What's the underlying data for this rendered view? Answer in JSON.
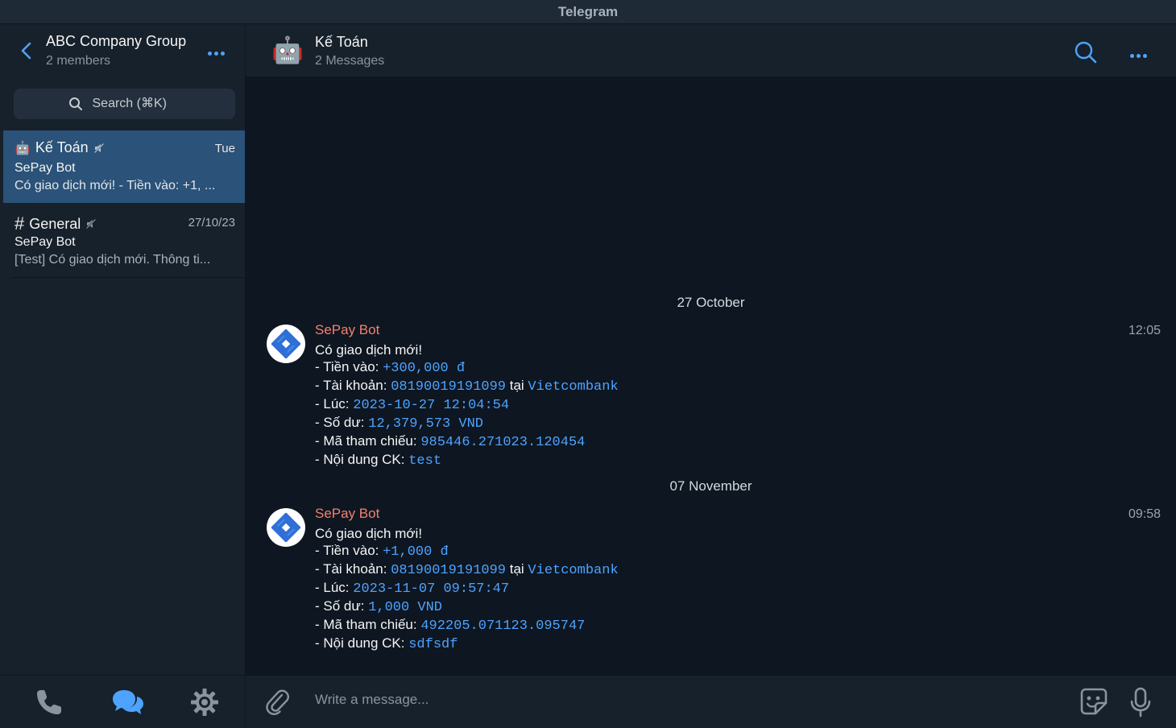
{
  "window": {
    "title": "Telegram"
  },
  "sidebar": {
    "group_title": "ABC Company Group",
    "group_subtitle": "2 members",
    "search_placeholder": "Search (⌘K)",
    "chats": [
      {
        "icon": "🤖",
        "name": "Kế Toán",
        "date": "Tue",
        "sender": "SePay Bot",
        "preview": "Có giao dịch mới! - Tiền vào: +1, ..."
      },
      {
        "icon": "#",
        "name": "General",
        "date": "27/10/23",
        "sender": "SePay Bot",
        "preview": "[Test] Có giao dịch mới. Thông ti..."
      }
    ]
  },
  "chat": {
    "avatar": "🤖",
    "title": "Kế Toán",
    "subtitle": "2 Messages"
  },
  "messages": [
    {
      "date_separator": "27 October",
      "sender": "SePay Bot",
      "time": "12:05",
      "heading": "Có giao dịch mới!",
      "labels": {
        "amount": "- Tiền vào: ",
        "account": "- Tài khoản: ",
        "at": " tại ",
        "time": "- Lúc: ",
        "balance": "- Số dư: ",
        "ref": "- Mã tham chiếu: ",
        "content": "- Nội dung CK: "
      },
      "amount": "+300,000 đ",
      "account": "08190019191099",
      "bank": "Vietcombank",
      "timestamp": "2023-10-27 12:04:54",
      "balance": "12,379,573 VND",
      "reference": "985446.271023.120454",
      "content": "test"
    },
    {
      "date_separator": "07 November",
      "sender": "SePay Bot",
      "time": "09:58",
      "heading": "Có giao dịch mới!",
      "labels": {
        "amount": "- Tiền vào: ",
        "account": "- Tài khoản: ",
        "at": " tại ",
        "time": "- Lúc: ",
        "balance": "- Số dư: ",
        "ref": "- Mã tham chiếu: ",
        "content": "- Nội dung CK: "
      },
      "amount": "+1,000 đ",
      "account": "08190019191099",
      "bank": "Vietcombank",
      "timestamp": "2023-11-07 09:57:47",
      "balance": "1,000 VND",
      "reference": "492205.071123.095747",
      "content": "sdfsdf"
    }
  ],
  "composer": {
    "placeholder": "Write a message..."
  },
  "colors": {
    "accent": "#4da3ff",
    "sender": "#f6806e",
    "active_chat": "#2b5278",
    "background": "#0e1621",
    "panel": "#17212b"
  }
}
